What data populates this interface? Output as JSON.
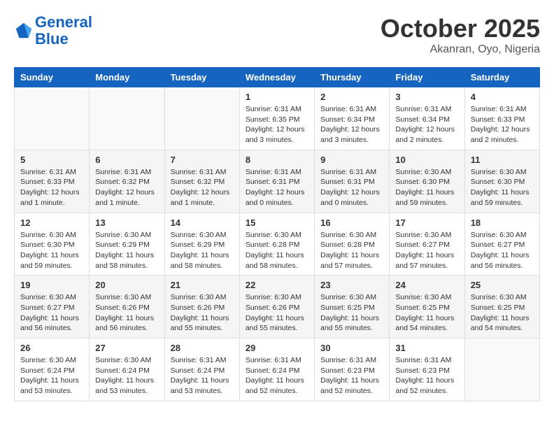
{
  "header": {
    "logo_line1": "General",
    "logo_line2": "Blue",
    "month": "October 2025",
    "location": "Akanran, Oyo, Nigeria"
  },
  "weekdays": [
    "Sunday",
    "Monday",
    "Tuesday",
    "Wednesday",
    "Thursday",
    "Friday",
    "Saturday"
  ],
  "weeks": [
    [
      {
        "day": "",
        "info": ""
      },
      {
        "day": "",
        "info": ""
      },
      {
        "day": "",
        "info": ""
      },
      {
        "day": "1",
        "info": "Sunrise: 6:31 AM\nSunset: 6:35 PM\nDaylight: 12 hours and 3 minutes."
      },
      {
        "day": "2",
        "info": "Sunrise: 6:31 AM\nSunset: 6:34 PM\nDaylight: 12 hours and 3 minutes."
      },
      {
        "day": "3",
        "info": "Sunrise: 6:31 AM\nSunset: 6:34 PM\nDaylight: 12 hours and 2 minutes."
      },
      {
        "day": "4",
        "info": "Sunrise: 6:31 AM\nSunset: 6:33 PM\nDaylight: 12 hours and 2 minutes."
      }
    ],
    [
      {
        "day": "5",
        "info": "Sunrise: 6:31 AM\nSunset: 6:33 PM\nDaylight: 12 hours and 1 minute."
      },
      {
        "day": "6",
        "info": "Sunrise: 6:31 AM\nSunset: 6:32 PM\nDaylight: 12 hours and 1 minute."
      },
      {
        "day": "7",
        "info": "Sunrise: 6:31 AM\nSunset: 6:32 PM\nDaylight: 12 hours and 1 minute."
      },
      {
        "day": "8",
        "info": "Sunrise: 6:31 AM\nSunset: 6:31 PM\nDaylight: 12 hours and 0 minutes."
      },
      {
        "day": "9",
        "info": "Sunrise: 6:31 AM\nSunset: 6:31 PM\nDaylight: 12 hours and 0 minutes."
      },
      {
        "day": "10",
        "info": "Sunrise: 6:30 AM\nSunset: 6:30 PM\nDaylight: 11 hours and 59 minutes."
      },
      {
        "day": "11",
        "info": "Sunrise: 6:30 AM\nSunset: 6:30 PM\nDaylight: 11 hours and 59 minutes."
      }
    ],
    [
      {
        "day": "12",
        "info": "Sunrise: 6:30 AM\nSunset: 6:30 PM\nDaylight: 11 hours and 59 minutes."
      },
      {
        "day": "13",
        "info": "Sunrise: 6:30 AM\nSunset: 6:29 PM\nDaylight: 11 hours and 58 minutes."
      },
      {
        "day": "14",
        "info": "Sunrise: 6:30 AM\nSunset: 6:29 PM\nDaylight: 11 hours and 58 minutes."
      },
      {
        "day": "15",
        "info": "Sunrise: 6:30 AM\nSunset: 6:28 PM\nDaylight: 11 hours and 58 minutes."
      },
      {
        "day": "16",
        "info": "Sunrise: 6:30 AM\nSunset: 6:28 PM\nDaylight: 11 hours and 57 minutes."
      },
      {
        "day": "17",
        "info": "Sunrise: 6:30 AM\nSunset: 6:27 PM\nDaylight: 11 hours and 57 minutes."
      },
      {
        "day": "18",
        "info": "Sunrise: 6:30 AM\nSunset: 6:27 PM\nDaylight: 11 hours and 56 minutes."
      }
    ],
    [
      {
        "day": "19",
        "info": "Sunrise: 6:30 AM\nSunset: 6:27 PM\nDaylight: 11 hours and 56 minutes."
      },
      {
        "day": "20",
        "info": "Sunrise: 6:30 AM\nSunset: 6:26 PM\nDaylight: 11 hours and 56 minutes."
      },
      {
        "day": "21",
        "info": "Sunrise: 6:30 AM\nSunset: 6:26 PM\nDaylight: 11 hours and 55 minutes."
      },
      {
        "day": "22",
        "info": "Sunrise: 6:30 AM\nSunset: 6:26 PM\nDaylight: 11 hours and 55 minutes."
      },
      {
        "day": "23",
        "info": "Sunrise: 6:30 AM\nSunset: 6:25 PM\nDaylight: 11 hours and 55 minutes."
      },
      {
        "day": "24",
        "info": "Sunrise: 6:30 AM\nSunset: 6:25 PM\nDaylight: 11 hours and 54 minutes."
      },
      {
        "day": "25",
        "info": "Sunrise: 6:30 AM\nSunset: 6:25 PM\nDaylight: 11 hours and 54 minutes."
      }
    ],
    [
      {
        "day": "26",
        "info": "Sunrise: 6:30 AM\nSunset: 6:24 PM\nDaylight: 11 hours and 53 minutes."
      },
      {
        "day": "27",
        "info": "Sunrise: 6:30 AM\nSunset: 6:24 PM\nDaylight: 11 hours and 53 minutes."
      },
      {
        "day": "28",
        "info": "Sunrise: 6:31 AM\nSunset: 6:24 PM\nDaylight: 11 hours and 53 minutes."
      },
      {
        "day": "29",
        "info": "Sunrise: 6:31 AM\nSunset: 6:24 PM\nDaylight: 11 hours and 52 minutes."
      },
      {
        "day": "30",
        "info": "Sunrise: 6:31 AM\nSunset: 6:23 PM\nDaylight: 11 hours and 52 minutes."
      },
      {
        "day": "31",
        "info": "Sunrise: 6:31 AM\nSunset: 6:23 PM\nDaylight: 11 hours and 52 minutes."
      },
      {
        "day": "",
        "info": ""
      }
    ]
  ]
}
